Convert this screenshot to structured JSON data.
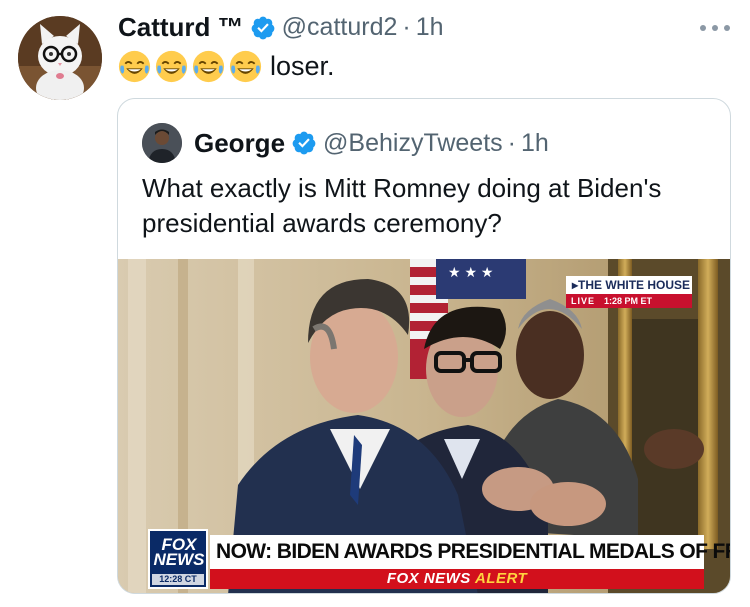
{
  "tweet": {
    "author": {
      "name": "Catturd ™",
      "handle": "@catturd2",
      "time": "1h",
      "verified": true,
      "avatar_icon": "cat-with-glasses-avatar"
    },
    "text": "loser.",
    "emojis": [
      "😂",
      "😂",
      "😂",
      "😂"
    ],
    "more_icon": "more-options-icon"
  },
  "quote": {
    "author": {
      "name": "George",
      "handle": "@BehizyTweets",
      "time": "1h",
      "verified": true
    },
    "text": "What exactly is Mitt Romney doing at Biden's presidential awards ceremony?",
    "media": {
      "bug_title": "THE WHITE HOUSE",
      "bug_live": "LIVE",
      "bug_time": "1:28 PM ET",
      "network_line1": "FOX",
      "network_line2": "NEWS",
      "network_clock": "12:28 CT",
      "headline": "NOW: BIDEN AWARDS PRESIDENTIAL MEDALS OF FREEDOM",
      "alert_brand": "FOX NEWS",
      "alert_word": "ALERT"
    }
  },
  "colors": {
    "verified": "#1d9bf0",
    "secondary_text": "#536471",
    "border": "#cfd9de",
    "fox_blue": "#0a2a66",
    "fox_red": "#d2101c"
  }
}
